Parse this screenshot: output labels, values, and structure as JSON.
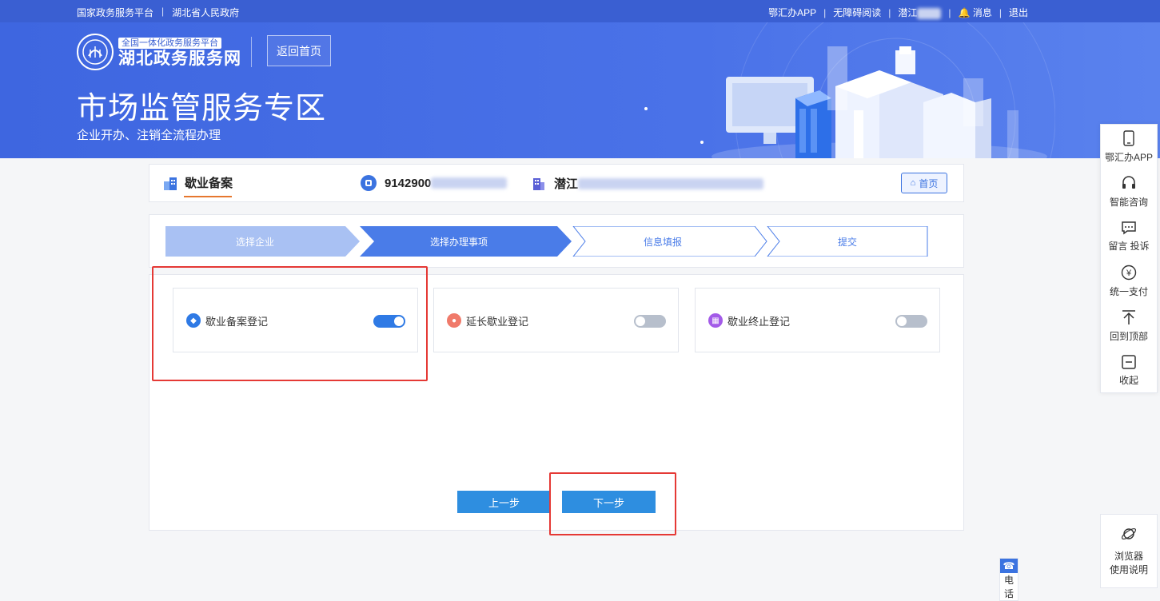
{
  "topbar": {
    "platform": "国家政务服务平台",
    "province_gov": "湖北省人民政府",
    "app_link": "鄂汇办APP",
    "accessible": "无障碍阅读",
    "user_prefix": "潜江",
    "message": "消息",
    "logout": "退出"
  },
  "header": {
    "logo_tag": "全国一体化政务服务平台",
    "logo_name": "湖北政务服务网",
    "back_home": "返回首页",
    "title": "市场监管服务专区",
    "subtitle": "企业开办、注销全流程办理"
  },
  "infobar": {
    "tab": "歇业备案",
    "code_prefix": "9142900",
    "company_prefix": "潜江",
    "home_button": "首页"
  },
  "steps": [
    {
      "label": "选择企业",
      "state": "done"
    },
    {
      "label": "选择办理事项",
      "state": "active"
    },
    {
      "label": "信息填报",
      "state": "todo"
    },
    {
      "label": "提交",
      "state": "todo"
    }
  ],
  "options": [
    {
      "label": "歇业备案登记",
      "icon": "tag-icon",
      "color": "#2f7ae5",
      "checked": true
    },
    {
      "label": "延长歇业登记",
      "icon": "person-icon",
      "color": "#f07a6a",
      "checked": false
    },
    {
      "label": "歇业终止登记",
      "icon": "calendar-icon",
      "color": "#a35be8",
      "checked": false
    }
  ],
  "buttons": {
    "prev": "上一步",
    "next": "下一步"
  },
  "side_float": [
    {
      "label": "鄂汇办APP",
      "icon": "phone-icon"
    },
    {
      "label": "智能咨询",
      "icon": "headset-icon"
    },
    {
      "label": "留言 投诉",
      "icon": "message-icon"
    },
    {
      "label": "统一支付",
      "icon": "yuan-icon"
    },
    {
      "label": "回到顶部",
      "icon": "to-top-icon"
    },
    {
      "label": "收起",
      "icon": "collapse-icon"
    }
  ],
  "help": {
    "line1": "浏览器",
    "line2": "使用说明"
  },
  "phone": {
    "label_1": "电",
    "label_2": "话"
  }
}
